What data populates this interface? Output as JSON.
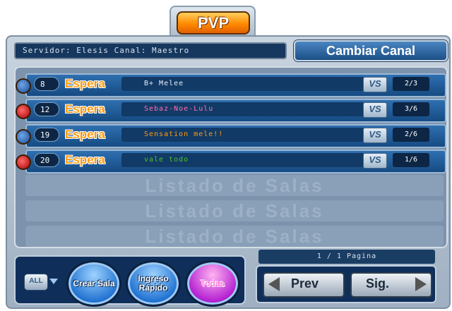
{
  "window": {
    "tab_title": "PVP"
  },
  "header": {
    "server_info": "Servidor: Elesis Canal: Maestro",
    "change_channel_label": "Cambiar Canal"
  },
  "rooms": [
    {
      "number": "8",
      "status": "Espera",
      "title": "B+ Melee",
      "vs": "VS",
      "players": "2/3",
      "team": "blue",
      "title_color": "#e6eef8"
    },
    {
      "number": "12",
      "status": "Espera",
      "title": "Sebaz-Noe-Lulu",
      "vs": "VS",
      "players": "3/6",
      "team": "red",
      "title_color": "#ff6fb0"
    },
    {
      "number": "19",
      "status": "Espera",
      "title": "Sensation mele!!",
      "vs": "VS",
      "players": "2/6",
      "team": "blue",
      "title_color": "#ff9a10"
    },
    {
      "number": "20",
      "status": "Espera",
      "title": "vale todo",
      "vs": "VS",
      "players": "1/6",
      "team": "red",
      "title_color": "#4fbf2a"
    }
  ],
  "empty_rows": [
    "Listado de Salas",
    "Listado de Salas",
    "Listado de Salas"
  ],
  "controls": {
    "filter_label": "ALL",
    "create_room": "Crear Sala",
    "quick_join": "Ingreso Rápido",
    "all_rooms": "Todas"
  },
  "pagination": {
    "indicator": "1 / 1 Pagina",
    "prev_label": "Prev",
    "next_label": "Sig."
  }
}
